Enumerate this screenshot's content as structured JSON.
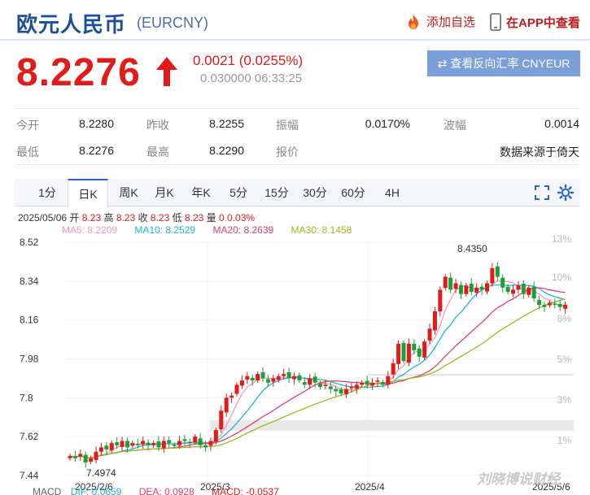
{
  "header": {
    "title": "欧元人民币",
    "code": "(EURCNY)",
    "add_favorite": "添加自选",
    "app_view": "在APP中查看"
  },
  "quote": {
    "price": "8.2276",
    "change": "0.0021 (0.0255%)",
    "sub": "0.030000 06:33:25",
    "reverse_button": "查看反向汇率 CNYEUR"
  },
  "stats": [
    {
      "label": "今开",
      "value": "8.2280"
    },
    {
      "label": "昨收",
      "value": "8.2255"
    },
    {
      "label": "振幅",
      "value": "0.0170%"
    },
    {
      "label": "波幅",
      "value": "0.0014"
    },
    {
      "label": "最低",
      "value": "8.2276"
    },
    {
      "label": "最高",
      "value": "8.2290"
    },
    {
      "label": "报价",
      "value": ""
    },
    {
      "label": "",
      "value": "数据来源于倚天"
    }
  ],
  "tabs": [
    "1分",
    "日K",
    "周K",
    "月K",
    "年K",
    "5分",
    "15分",
    "30分",
    "60分",
    "4H"
  ],
  "active_tab": "日K",
  "info": {
    "date": "2025/05/06",
    "open_label": "开",
    "open": "8.23",
    "high_label": "高",
    "high": "8.23",
    "close_label": "收",
    "close": "8.23",
    "low_label": "低",
    "low": "8.23",
    "vol_label": "量",
    "vol": "0",
    "pct": "0.03%"
  },
  "ma": [
    {
      "label": "MA5: 8.2209",
      "color": "#f29bb4"
    },
    {
      "label": "MA10: 8.2529",
      "color": "#1fb5d3"
    },
    {
      "label": "MA20: 8.2639",
      "color": "#e0406a"
    },
    {
      "label": "MA30: 8.1458",
      "color": "#9cbb1c"
    }
  ],
  "chart_data": {
    "type": "candlestick",
    "y_ticks": [
      "8.52",
      "8.34",
      "8.16",
      "7.98",
      "7.8",
      "7.62",
      "7.44"
    ],
    "y_values": [
      8.52,
      8.34,
      8.16,
      7.98,
      7.8,
      7.62,
      7.44
    ],
    "pct_ticks": [
      "13%",
      "10%",
      "8%",
      "5%",
      "3%",
      "1%"
    ],
    "pct_values": [
      13,
      10,
      8,
      5,
      3,
      1
    ],
    "x_ticks": [
      "2025/2/6",
      "2025/3",
      "2025/4",
      "2025/5/6"
    ],
    "annotations": {
      "max": "8.4350",
      "min": "7.4974"
    },
    "ylim": [
      7.44,
      8.52
    ],
    "closes": [
      7.53,
      7.52,
      7.54,
      7.5,
      7.52,
      7.55,
      7.57,
      7.56,
      7.59,
      7.58,
      7.6,
      7.57,
      7.59,
      7.58,
      7.6,
      7.58,
      7.59,
      7.57,
      7.6,
      7.59,
      7.58,
      7.6,
      7.6,
      7.59,
      7.62,
      7.58,
      7.57,
      7.6,
      7.65,
      7.74,
      7.8,
      7.81,
      7.86,
      7.88,
      7.9,
      7.88,
      7.91,
      7.89,
      7.87,
      7.89,
      7.9,
      7.91,
      7.89,
      7.9,
      7.88,
      7.86,
      7.89,
      7.87,
      7.85,
      7.86,
      7.84,
      7.83,
      7.82,
      7.84,
      7.85,
      7.86,
      7.87,
      7.86,
      7.87,
      7.88,
      7.86,
      7.9,
      7.96,
      8.05,
      7.97,
      8.05,
      8.02,
      7.99,
      8.06,
      8.12,
      8.2,
      8.3,
      8.36,
      8.3,
      8.33,
      8.28,
      8.32,
      8.29,
      8.31,
      8.3,
      8.33,
      8.4,
      8.36,
      8.31,
      8.29,
      8.3,
      8.32,
      8.28,
      8.31,
      8.26,
      8.23,
      8.22,
      8.24,
      8.23,
      8.22,
      8.23
    ]
  },
  "macd": {
    "label": "MACD",
    "dif": "DIF: 0.0659",
    "dea": "DEA: 0.0928",
    "macd": "MACD: -0.0537"
  },
  "watermark": "刘晓博说财经",
  "colors": {
    "up": "#e31a1a",
    "down": "#1e9e3a",
    "brand": "#1d4e9c"
  }
}
